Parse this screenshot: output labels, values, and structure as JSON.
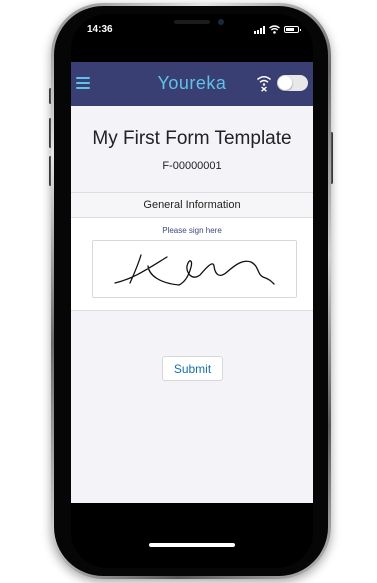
{
  "status_bar": {
    "time": "14:36"
  },
  "header": {
    "app_name": "Youreka",
    "menu_icon": "hamburger-menu-icon",
    "offline_icon": "wifi-off-icon",
    "offline_toggle_on": false
  },
  "form": {
    "title": "My First Form Template",
    "number": "F-00000001",
    "section_title": "General Information",
    "signature_prompt": "Please sign here",
    "submit_label": "Submit"
  },
  "colors": {
    "header_bg": "#3a3f73",
    "brand_accent": "#5fc2e8",
    "link_blue": "#1a6fb0"
  }
}
